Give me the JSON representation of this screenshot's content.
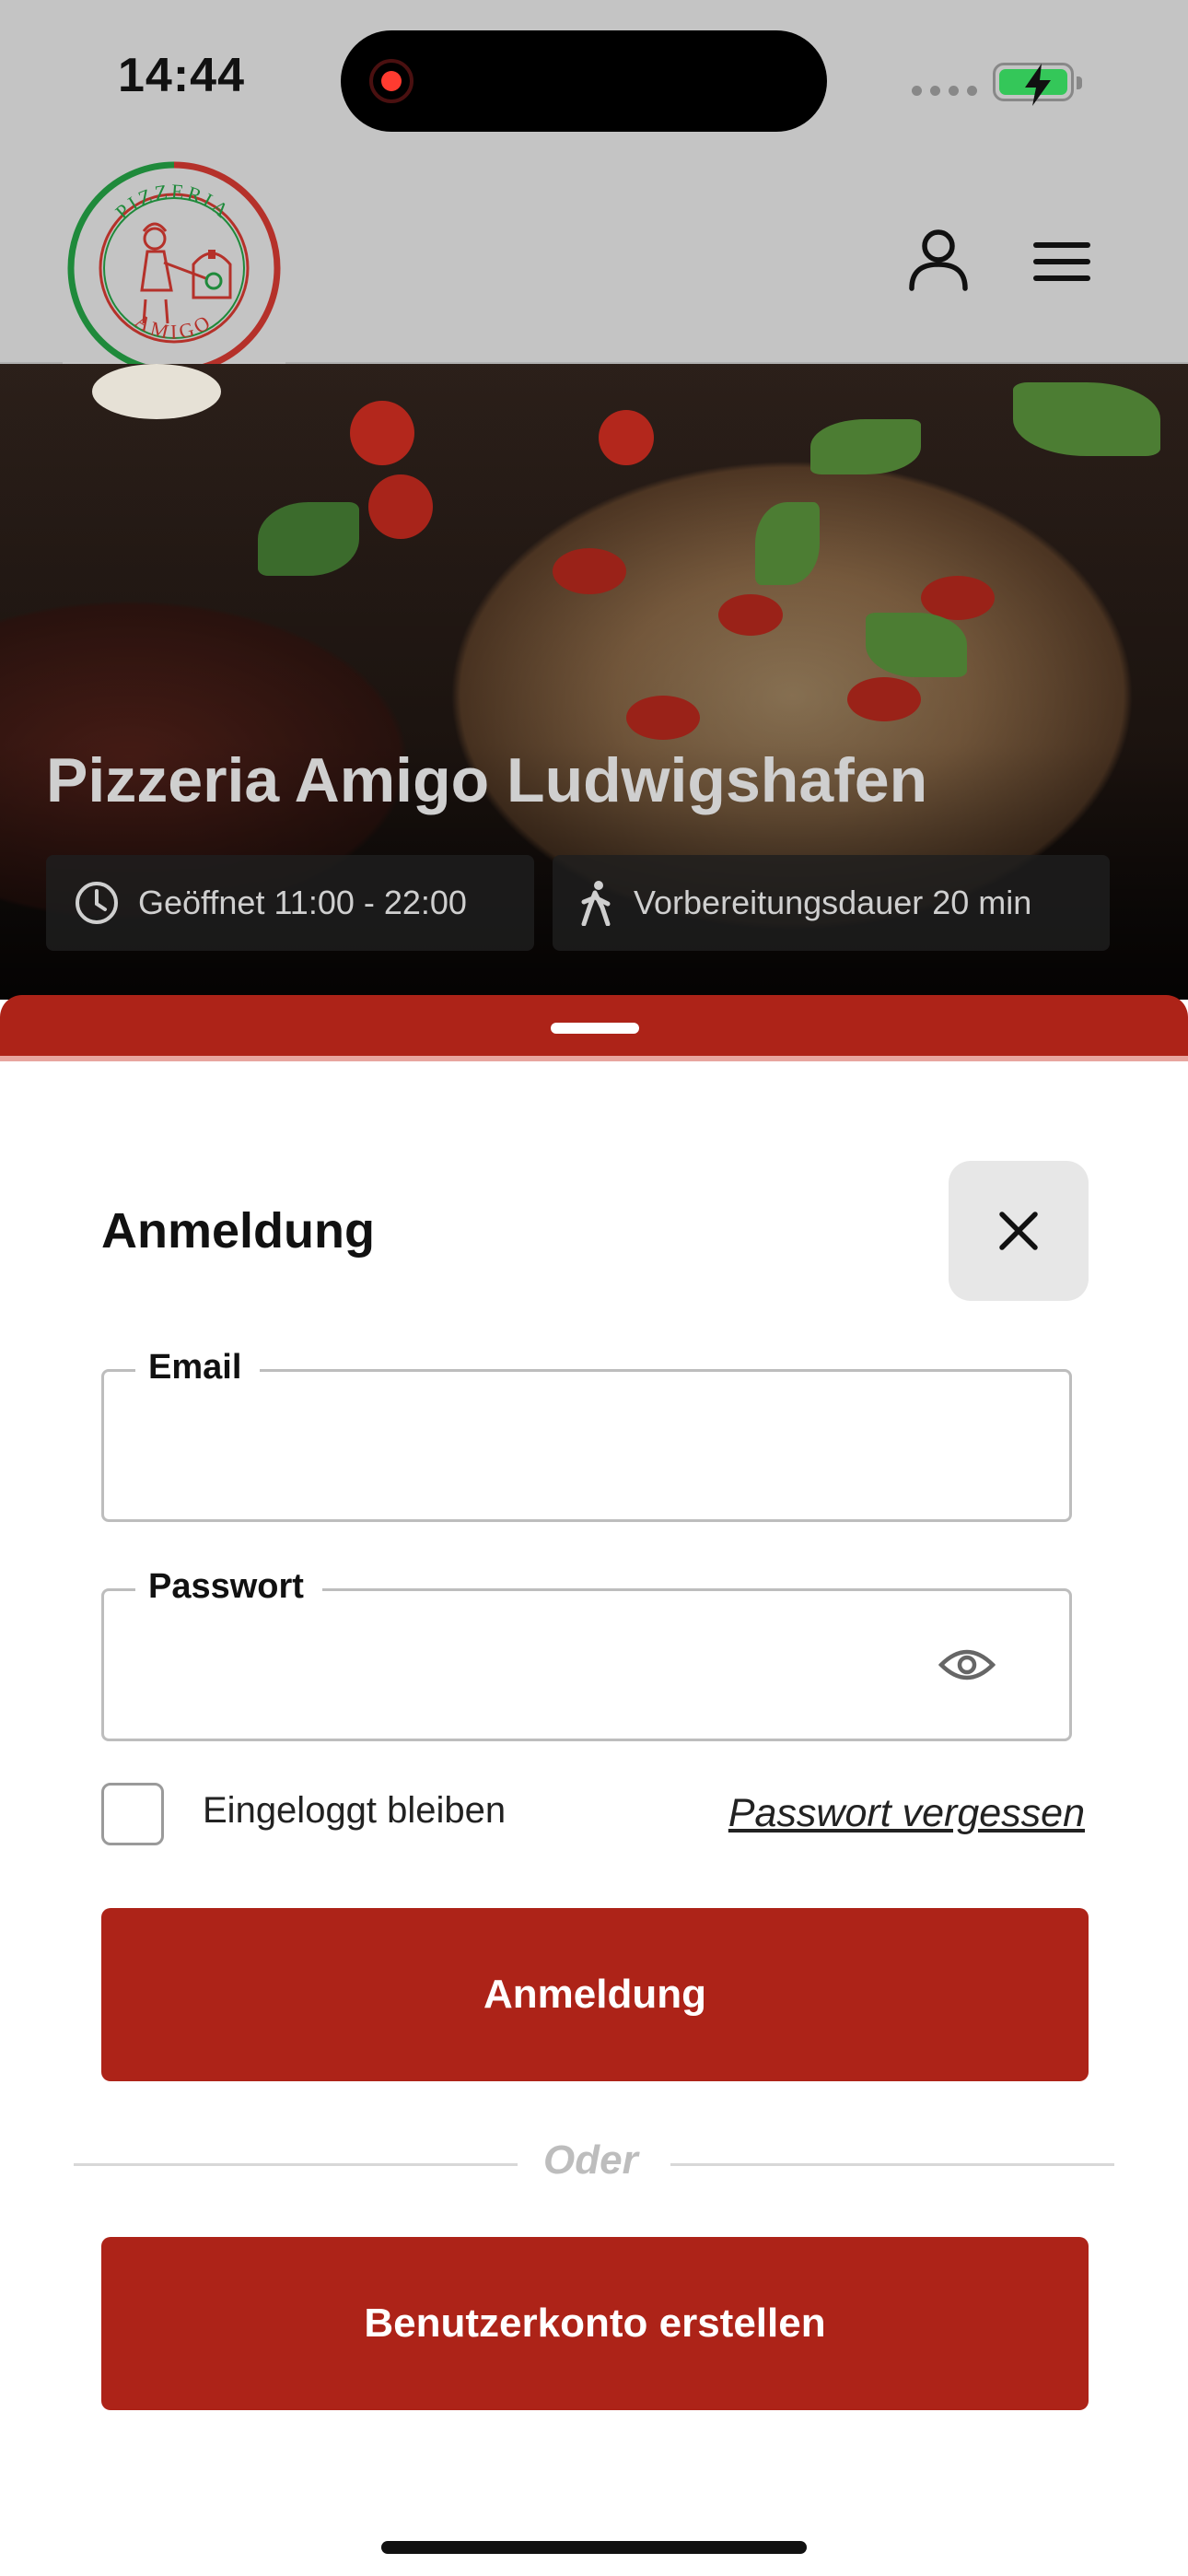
{
  "status_bar": {
    "time": "14:44"
  },
  "header": {
    "logo_text_top": "PIZZERIA",
    "logo_text_bottom": "AMIGO",
    "colors": {
      "green": "#1f8a3b",
      "red": "#b5312a"
    }
  },
  "hero": {
    "title": "Pizzeria Amigo Ludwigshafen",
    "opening_hours": "Geöffnet 11:00 - 22:00",
    "prep_time": "Vorbereitungsdauer 20 min"
  },
  "login": {
    "title": "Anmeldung",
    "email_label": "Email",
    "email_value": "",
    "password_label": "Passwort",
    "password_value": "",
    "remember_label": "Eingeloggt bleiben",
    "remember_checked": false,
    "forgot_label": "Passwort vergessen",
    "login_button": "Anmeldung",
    "or_label": "Oder",
    "register_button": "Benutzerkonto erstellen"
  },
  "colors": {
    "accent": "#ad2318",
    "status_bar_bg": "#c4c4c4"
  }
}
